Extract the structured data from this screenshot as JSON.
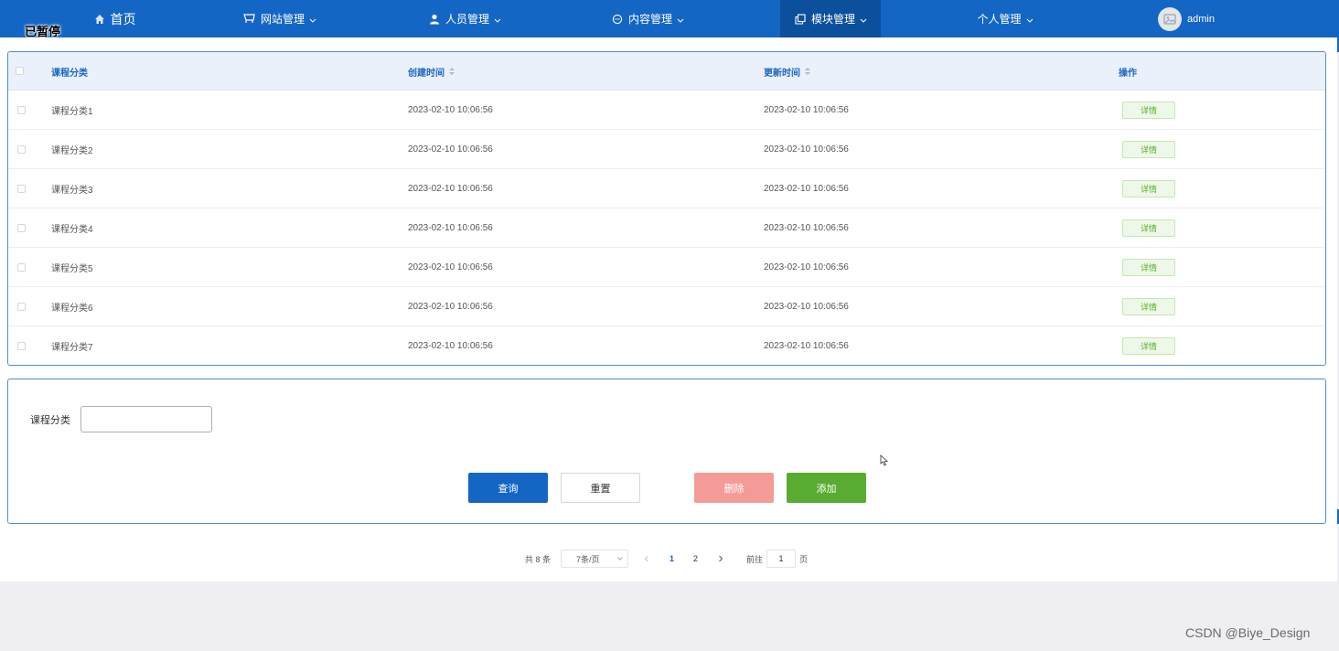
{
  "paused_overlay": "已暂停",
  "nav": {
    "home": "首页",
    "site_mgmt": "网站管理",
    "people_mgmt": "人员管理",
    "content_mgmt": "内容管理",
    "module_mgmt": "模块管理",
    "personal_mgmt": "个人管理",
    "user": "admin"
  },
  "table": {
    "headers": {
      "category": "课程分类",
      "created": "创建时间",
      "updated": "更新时间",
      "actions": "操作"
    },
    "rows": [
      {
        "category": "课程分类1",
        "created": "2023-02-10 10:06:56",
        "updated": "2023-02-10 10:06:56",
        "action": "详情"
      },
      {
        "category": "课程分类2",
        "created": "2023-02-10 10:06:56",
        "updated": "2023-02-10 10:06:56",
        "action": "详情"
      },
      {
        "category": "课程分类3",
        "created": "2023-02-10 10:06:56",
        "updated": "2023-02-10 10:06:56",
        "action": "详情"
      },
      {
        "category": "课程分类4",
        "created": "2023-02-10 10:06:56",
        "updated": "2023-02-10 10:06:56",
        "action": "详情"
      },
      {
        "category": "课程分类5",
        "created": "2023-02-10 10:06:56",
        "updated": "2023-02-10 10:06:56",
        "action": "详情"
      },
      {
        "category": "课程分类6",
        "created": "2023-02-10 10:06:56",
        "updated": "2023-02-10 10:06:56",
        "action": "详情"
      },
      {
        "category": "课程分类7",
        "created": "2023-02-10 10:06:56",
        "updated": "2023-02-10 10:06:56",
        "action": "详情"
      }
    ]
  },
  "search": {
    "label": "课程分类",
    "value": "",
    "buttons": {
      "query": "查询",
      "reset": "重置",
      "delete": "删除",
      "add": "添加"
    }
  },
  "pagination": {
    "total": "共 8 条",
    "page_size": "7条/页",
    "pages": [
      "1",
      "2"
    ],
    "current_page": "1",
    "goto_prefix": "前往",
    "goto_value": "1",
    "goto_suffix": "页"
  },
  "watermark": "CSDN @Biye_Design",
  "colors": {
    "primary": "#1466c5",
    "danger": "#f59b97",
    "success": "#59ab32"
  }
}
